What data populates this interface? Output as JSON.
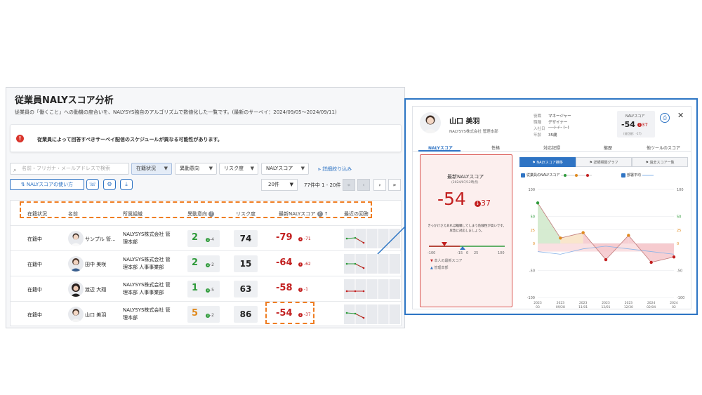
{
  "page": {
    "title": "従業員NALYスコア分析",
    "description": "従業員の「働くこと」への動機の度合いを、NALYSYS独自のアルゴリズムで数値化した一覧です。(最新のサーベイ：2024/09/05〜2024/09/11)"
  },
  "alert": {
    "icon": "!",
    "message": "従業員によって回答すべきサーベイ配信のスケジュールが異なる可能性があります。"
  },
  "filters": {
    "search_placeholder": "名前・フリガナ・メールアドレスで検索",
    "dropdowns": [
      "在籍状況",
      "異動意向",
      "リスク度",
      "NALYスコア"
    ],
    "detail_link": "詳細絞り込み",
    "howto_button": "NALYスコアの使い方",
    "page_size": "20件",
    "page_info": "77件中 1 - 20件"
  },
  "table": {
    "headers": [
      "在籍状況",
      "名前",
      "所属組織",
      "異動意向",
      "リスク度",
      "最新NALYスコア",
      "最近の回答"
    ],
    "rows": [
      {
        "status": "在籍中",
        "name": "サンプル 管...",
        "org1": "NALYSYS株式会社 管",
        "org2": "理本部",
        "motive": "2",
        "motive_delta": "-4",
        "risk": "74",
        "naly": "-79",
        "naly_delta": "-71"
      },
      {
        "status": "在籍中",
        "name": "田中 美咲",
        "org1": "NALYSYS株式会社 管",
        "org2": "理本部 人事事業部",
        "motive": "2",
        "motive_delta": "-2",
        "risk": "15",
        "naly": "-64",
        "naly_delta": "-62"
      },
      {
        "status": "在籍中",
        "name": "渡辺 大翔",
        "org1": "NALYSYS株式会社 管",
        "org2": "理本部 人事事業部",
        "motive": "1",
        "motive_delta": "-5",
        "risk": "63",
        "naly": "-58",
        "naly_delta": "-1"
      },
      {
        "status": "在籍中",
        "name": "山口 美羽",
        "org1": "NALYSYS株式会社 管",
        "org2": "理本部",
        "motive": "5",
        "motive_delta": "-2",
        "risk": "86",
        "naly": "-54",
        "naly_delta": "-37"
      }
    ]
  },
  "detail": {
    "name": "山口 美羽",
    "org": "NALYSYS株式会社 管理本部",
    "info": [
      {
        "k": "役職",
        "v": "マネージャー"
      },
      {
        "k": "職種",
        "v": "デザイナー"
      },
      {
        "k": "入社日",
        "v": "----/--/-- (--)"
      },
      {
        "k": "年齢",
        "v": "35歳"
      }
    ],
    "score_label": "NALYスコア",
    "score": "-54",
    "score_delta": "37",
    "score_prev": "(前回値：-17)",
    "tabs": [
      "NALYスコア",
      "性格",
      "対応記録",
      "継歴",
      "他ツールのスコア"
    ],
    "card": {
      "title": "最新NALYスコア",
      "date": "(2024/07/12時点)",
      "score": "-54",
      "delta": "37",
      "message": "きっかけさえあれば離職してしまう危険性が高いです。早急に対応しましょう。",
      "scale": [
        "-100",
        "-15",
        "0",
        "25",
        "100"
      ],
      "legend_self": "本人の最新スコア",
      "legend_dept": "管理本部"
    },
    "subtabs": [
      "NALYスコア推移",
      "詳細相関グラフ",
      "過去スコア一覧"
    ],
    "legend": {
      "self": "従業員のNALYスコア",
      "avg": "部署平均"
    },
    "colors": {
      "positive": "#2e9a3a",
      "warning": "#e08a1e",
      "negative": "#c21f1f",
      "accent": "#2f74c4"
    }
  },
  "chart_data": {
    "type": "line",
    "x": [
      "2023/03",
      "2023/09/28",
      "2023/11/01",
      "2023/12/01",
      "2023/12/30",
      "2024/02/04",
      "2024/02"
    ],
    "series": [
      {
        "name": "従業員のNALYスコア",
        "values": [
          75,
          10,
          20,
          -30,
          15,
          -35,
          -25
        ]
      },
      {
        "name": "部署平均",
        "values": [
          -15,
          -20,
          -10,
          -5,
          -10,
          -15,
          -20
        ]
      }
    ],
    "yticks": [
      100,
      50,
      25,
      0,
      -50,
      -100
    ],
    "ylim": [
      -100,
      100
    ]
  }
}
